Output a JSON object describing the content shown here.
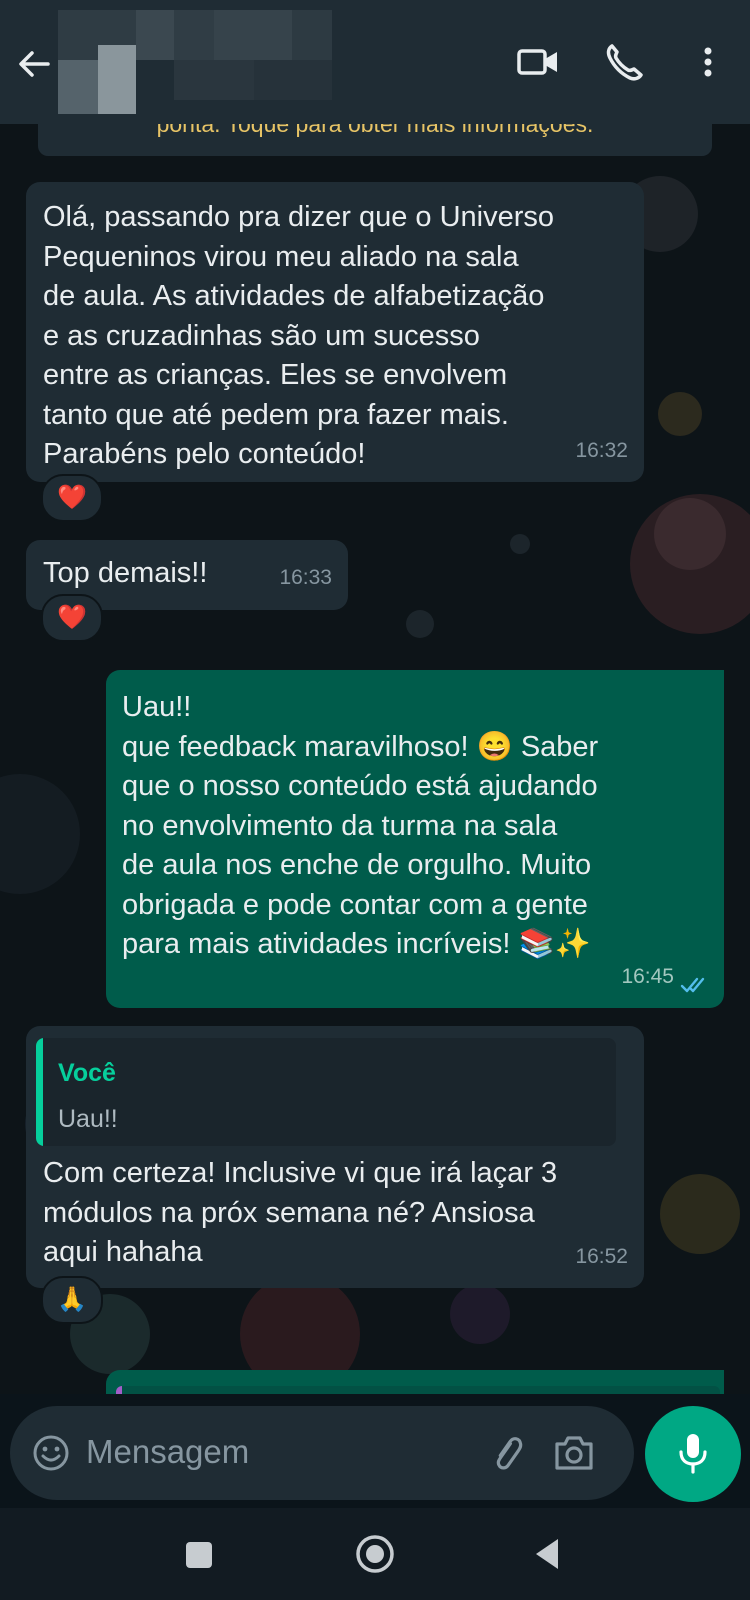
{
  "header": {
    "contact_name_hidden": true
  },
  "system_banner": {
    "text": "ponta. Toque para obter mais informações."
  },
  "messages": [
    {
      "direction": "in",
      "text": "Olá, passando pra dizer que o Universo\nPequeninos virou meu aliado na sala\nde aula. As atividades de alfabetização\ne as cruzadinhas são um sucesso\nentre as crianças. Eles se envolvem\ntanto que até pedem pra fazer mais.\nParabéns pelo conteúdo!",
      "time": "16:32",
      "reaction": "❤️"
    },
    {
      "direction": "in",
      "text": "Top demais!!",
      "time": "16:33",
      "reaction": "❤️"
    },
    {
      "direction": "out",
      "text": "Uau!!\nque feedback maravilhoso! 😄 Saber\nque o nosso conteúdo está ajudando\nno envolvimento da turma na sala\nde aula nos enche de orgulho. Muito\nobrigada e pode contar com a gente\npara mais atividades incríveis! 📚✨",
      "time": "16:45",
      "status": "read"
    },
    {
      "direction": "in",
      "quote_author": "Você",
      "quote_text": "Uau!!",
      "text": "Com certeza! Inclusive vi que irá laçar 3\nmódulos na próx semana né? Ansiosa\naqui hahaha",
      "time": "16:52",
      "reaction": "🙏"
    }
  ],
  "input": {
    "placeholder": "Mensagem"
  },
  "icons": {
    "back": "arrow-left-icon",
    "video": "video-call-icon",
    "phone": "phone-icon",
    "menu": "more-vertical-icon",
    "emoji": "emoji-icon",
    "attach": "paperclip-icon",
    "camera": "camera-icon",
    "mic": "microphone-icon"
  },
  "colors": {
    "incoming_bubble": "#1f2c34",
    "outgoing_bubble": "#005c4b",
    "accent": "#00a884",
    "read_ticks": "#53bdeb"
  }
}
